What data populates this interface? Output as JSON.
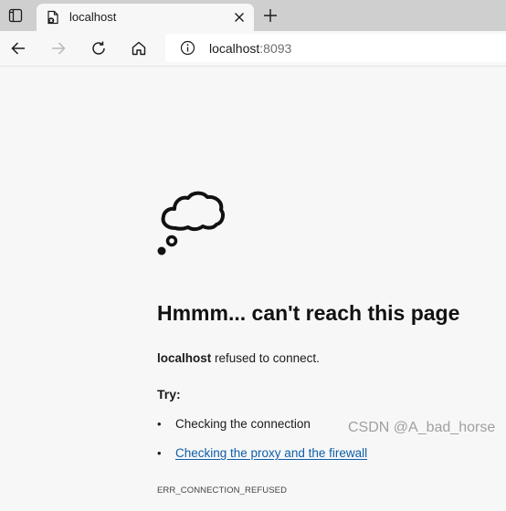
{
  "browser": {
    "tab": {
      "title": "localhost",
      "favicon": "error-page-icon"
    },
    "icons": {
      "tab_actions": "tab-actions-icon",
      "close": "close-icon",
      "new_tab": "plus-icon",
      "back": "back-arrow-icon",
      "forward": "forward-arrow-icon",
      "refresh": "refresh-icon",
      "home": "home-icon",
      "site_info": "info-icon"
    },
    "address_bar": {
      "host": "localhost",
      "port": ":8093"
    }
  },
  "error_page": {
    "illustration": "thought-cloud-icon",
    "title": "Hmmm... can't reach this page",
    "host": "localhost",
    "description": " refused to connect.",
    "try_heading": "Try:",
    "suggestions": [
      {
        "text": "Checking the connection",
        "is_link": false
      },
      {
        "text": "Checking the proxy and the firewall",
        "is_link": true
      }
    ],
    "bullet": "•",
    "error_code": "ERR_CONNECTION_REFUSED"
  },
  "watermark": "CSDN @A_bad_horse",
  "colors": {
    "tabstrip": "#cfcfcf",
    "page_background": "#f7f7f7",
    "link": "#0e5ea8",
    "text": "#1b1b1b"
  }
}
